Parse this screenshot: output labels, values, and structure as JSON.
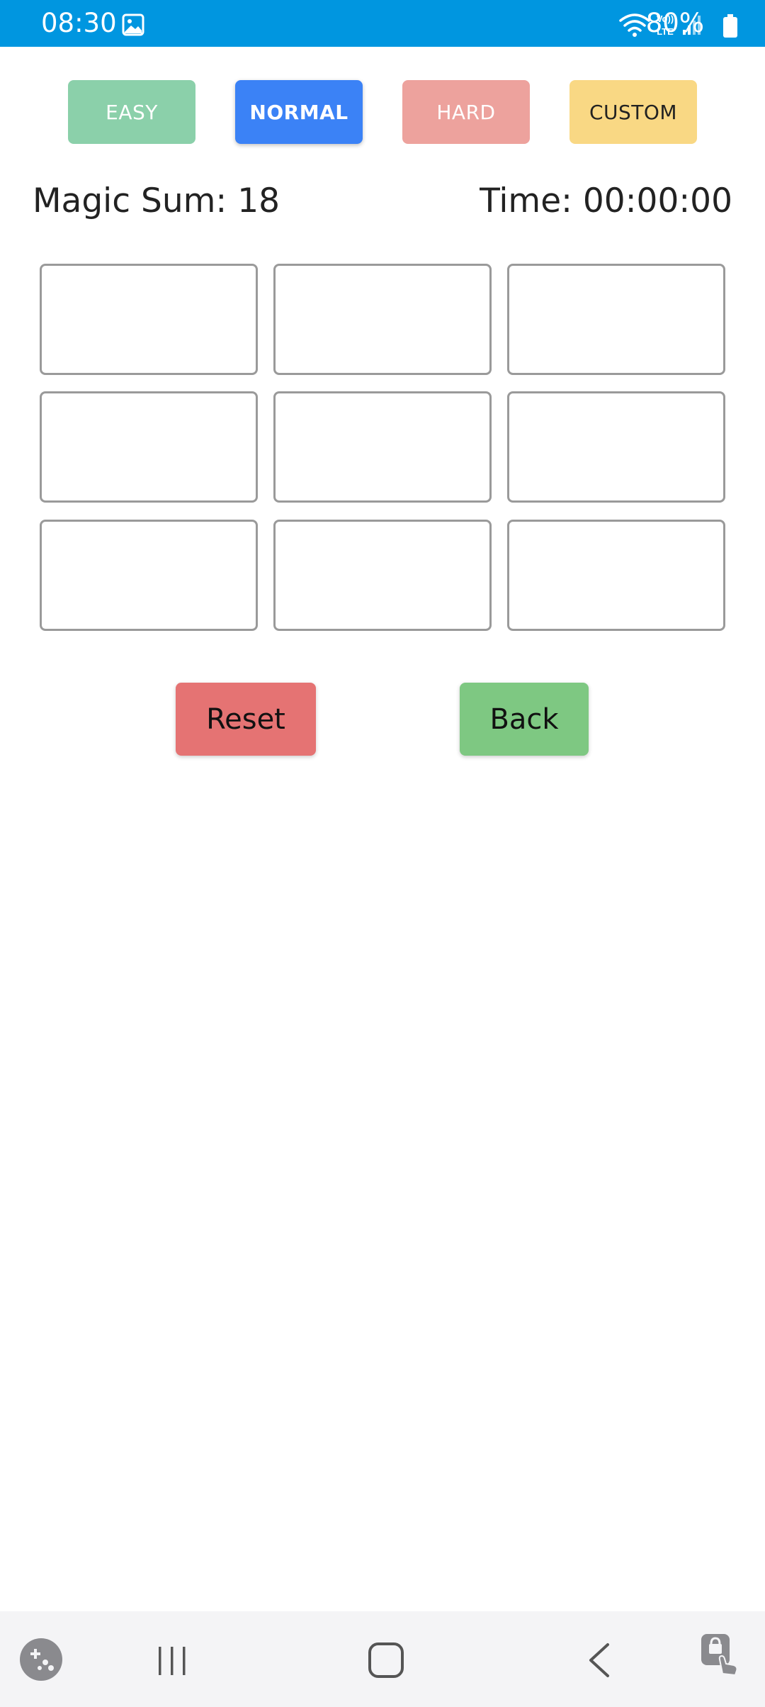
{
  "status_bar": {
    "time": "08:30",
    "battery_text": "80%",
    "background": "#0096e0",
    "icons": [
      "gallery-icon",
      "wifi-icon",
      "volte-icon",
      "signal-icon",
      "battery-icon"
    ]
  },
  "difficulty": {
    "easy_label": "EASY",
    "normal_label": "NORMAL",
    "hard_label": "HARD",
    "custom_label": "CUSTOM",
    "selected": "NORMAL",
    "colors": {
      "easy": "#8bd0aa",
      "normal": "#3b82f6",
      "hard": "#eda29d",
      "custom": "#f9d884"
    }
  },
  "info": {
    "magic_sum": "Magic Sum: 18",
    "timer": "Time: 00:00:00"
  },
  "grid": {
    "cells": [
      "",
      "",
      "",
      "",
      "",
      "",
      "",
      "",
      ""
    ]
  },
  "actions": {
    "reset_label": "Reset",
    "back_label": "Back",
    "reset_color": "#e57373",
    "back_color": "#7ec882"
  },
  "nav_bar": {
    "icons": [
      "game-tools-icon",
      "recents-icon",
      "home-icon",
      "back-icon",
      "touch-lock-icon"
    ]
  }
}
